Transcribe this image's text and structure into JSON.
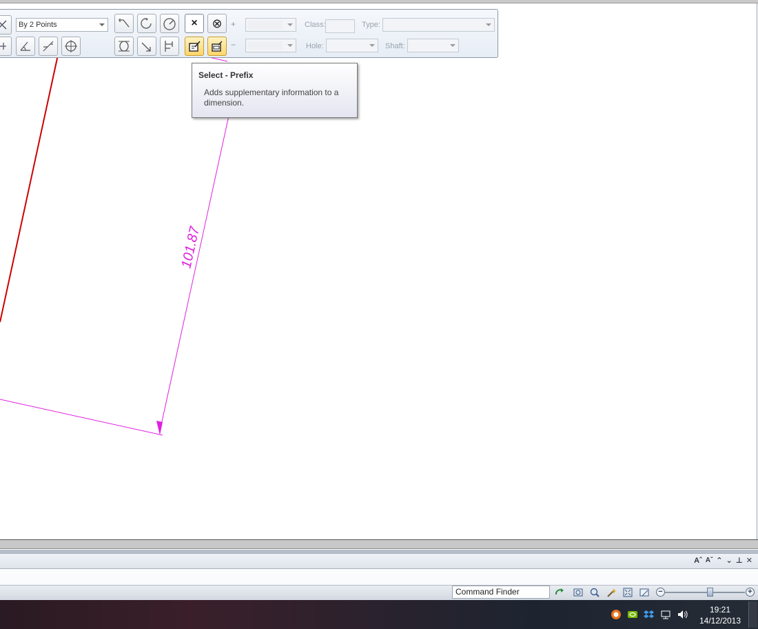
{
  "toolbar": {
    "mode_combo": "By 2 Points",
    "plus_sign": "+",
    "minus_sign": "−",
    "class_label": "Class:",
    "type_label": "Type:",
    "hole_label": "Hole:",
    "shaft_label": "Shaft:",
    "select_button_glyph": "×",
    "deselect_button_glyph": "⊗"
  },
  "tooltip": {
    "title": "Select - Prefix",
    "body": "Adds supplementary information to a dimension."
  },
  "drawing": {
    "dimension_value": "101.87",
    "line_color": "#cc0000",
    "dimension_color": "#e020e0"
  },
  "panel": {
    "icons": [
      "font-increase-icon",
      "font-decrease-icon",
      "collapse-up-icon",
      "collapse-down-icon",
      "pin-icon",
      "close-icon"
    ]
  },
  "statusbar": {
    "command_finder": "Command Finder"
  },
  "taskbar": {
    "time": "19:21",
    "date": "14/12/2013"
  }
}
